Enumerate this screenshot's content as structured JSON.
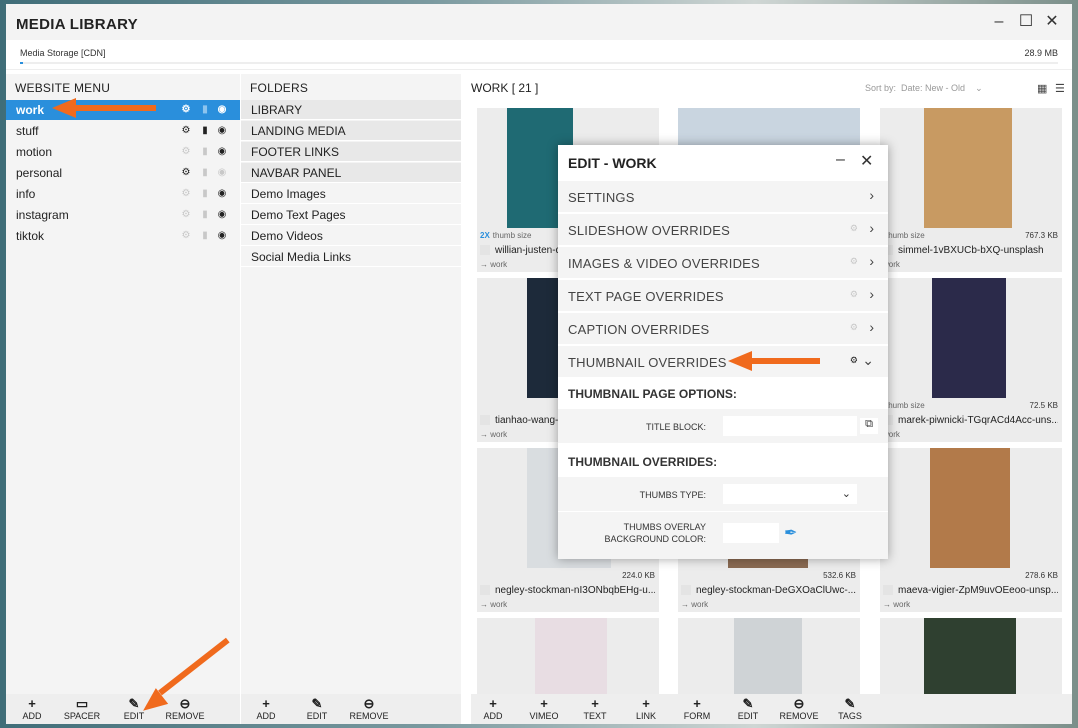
{
  "window": {
    "title": "MEDIA LIBRARY"
  },
  "storage": {
    "label": "Media Storage [CDN]",
    "size": "28.9 MB"
  },
  "website_menu": {
    "header": "WEBSITE MENU",
    "items": [
      {
        "label": "work",
        "selected": true
      },
      {
        "label": "stuff"
      },
      {
        "label": "motion"
      },
      {
        "label": "personal"
      },
      {
        "label": "info"
      },
      {
        "label": "instagram"
      },
      {
        "label": "tiktok"
      }
    ],
    "toolbar": [
      "ADD",
      "SPACER",
      "EDIT",
      "REMOVE"
    ]
  },
  "folders": {
    "header": "FOLDERS",
    "items": [
      "LIBRARY",
      "LANDING MEDIA",
      "FOOTER LINKS",
      "NAVBAR PANEL",
      "Demo Images",
      "Demo Text Pages",
      "Demo Videos",
      "Social Media Links"
    ],
    "toolbar": [
      "ADD",
      "EDIT",
      "REMOVE"
    ]
  },
  "work": {
    "title": "WORK",
    "count": "[ 21 ]",
    "sort_label": "Sort by:",
    "sort_value": "Date: New - Old",
    "toolbar": [
      "ADD",
      "VIMEO",
      "TEXT",
      "LINK",
      "FORM",
      "EDIT",
      "REMOVE",
      "TAGS"
    ],
    "cards": [
      {
        "size_left": "2X",
        "size_left_suffix": "thumb size",
        "size_right": "",
        "name": "willian-justen-de",
        "folder": "→ work",
        "color": "#1f6a73"
      },
      {
        "size_left": "",
        "size_left_suffix": "",
        "size_right": "",
        "name": "",
        "folder": "",
        "color": "#c9d5e0"
      },
      {
        "size_left": "",
        "size_left_suffix": "thumb size",
        "size_right": "767.3 KB",
        "name": "simmel-1vBXUCb-bXQ-unsplash",
        "folder": "work",
        "color": "#c89a62"
      },
      {
        "size_left": "",
        "size_left_suffix": "",
        "size_right": "",
        "name": "tianhao-wang-a",
        "folder": "→ work",
        "color": "#1d2a3a"
      },
      {
        "size_left": "",
        "size_left_suffix": "",
        "size_right": "",
        "name": "",
        "folder": "",
        "color": "#556"
      },
      {
        "size_left": "",
        "size_left_suffix": "thumb size",
        "size_right": "72.5 KB",
        "name": "marek-piwnicki-TGqrACd4Acc-uns...",
        "folder": "work",
        "color": "#2b2a4a"
      },
      {
        "size_left": "",
        "size_left_suffix": "",
        "size_right": "224.0 KB",
        "name": "negley-stockman-nI3ONbqbEHg-u...",
        "folder": "→ work",
        "color": "#d9dde0"
      },
      {
        "size_left": "",
        "size_left_suffix": "",
        "size_right": "532.6 KB",
        "name": "negley-stockman-DeGXOaClUwc-...",
        "folder": "→ work",
        "color": "#8a6a52"
      },
      {
        "size_left": "",
        "size_left_suffix": "",
        "size_right": "278.6 KB",
        "name": "maeva-vigier-ZpM9uvOEeoo-unsp...",
        "folder": "→ work",
        "color": "#b27a4a"
      },
      {
        "size_left": "",
        "size_left_suffix": "",
        "size_right": "",
        "name": "",
        "folder": "",
        "color": "#e8dde3"
      },
      {
        "size_left": "",
        "size_left_suffix": "",
        "size_right": "",
        "name": "",
        "folder": "",
        "color": "#cfd3d6"
      },
      {
        "size_left": "",
        "size_left_suffix": "",
        "size_right": "",
        "name": "",
        "folder": "",
        "color": "#2f4030"
      }
    ]
  },
  "edit_modal": {
    "title": "EDIT - WORK",
    "rows": [
      {
        "label": "SETTINGS",
        "gear": false
      },
      {
        "label": "SLIDESHOW OVERRIDES",
        "gear": true
      },
      {
        "label": "IMAGES & VIDEO OVERRIDES",
        "gear": true
      },
      {
        "label": "TEXT PAGE OVERRIDES",
        "gear": true
      },
      {
        "label": "CAPTION OVERRIDES",
        "gear": true
      },
      {
        "label": "THUMBNAIL OVERRIDES",
        "gear": true,
        "expanded": true
      }
    ],
    "section1": "THUMBNAIL PAGE OPTIONS:",
    "title_block_label": "TITLE BLOCK:",
    "section2": "THUMBNAIL OVERRIDES:",
    "thumbs_type_label": "THUMBS TYPE:",
    "overlay_label_1": "THUMBS OVERLAY",
    "overlay_label_2": "BACKGROUND COLOR:"
  },
  "colors": {
    "accent": "#2a8fdc",
    "arrow": "#f06a1d"
  }
}
